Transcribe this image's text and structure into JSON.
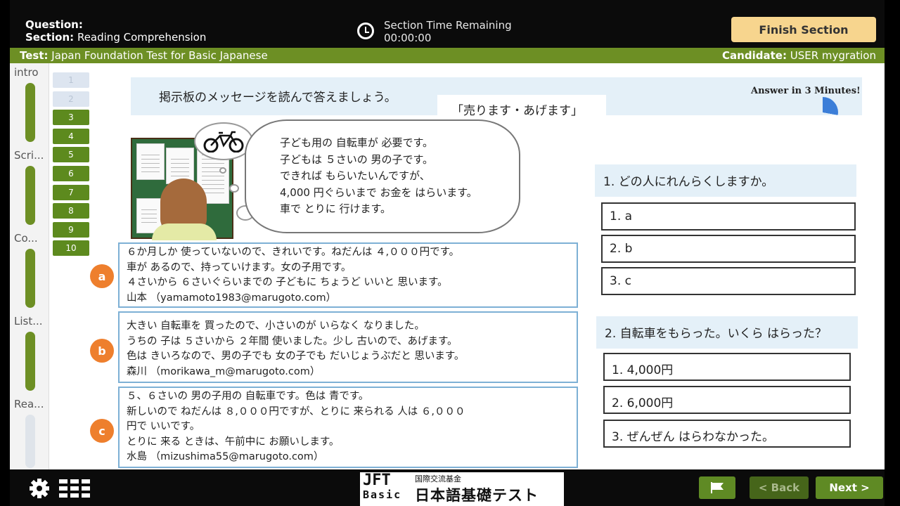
{
  "header": {
    "question_label": "Question:",
    "section_label": "Section:",
    "section_name": "Reading Comprehension",
    "timer_title": "Section Time Remaining",
    "timer_value": "00:00:00",
    "finish_label": "Finish Section"
  },
  "testbar": {
    "test_label": "Test:",
    "test_name": "Japan Foundation Test for Basic Japanese",
    "candidate_label": "Candidate:",
    "candidate_name": "USER mygration"
  },
  "left_nav": {
    "sections": [
      {
        "label": "intro",
        "done": true
      },
      {
        "label": "Scri...",
        "done": true
      },
      {
        "label": "Co...",
        "done": true
      },
      {
        "label": "List...",
        "done": true
      },
      {
        "label": "Rea...",
        "done": false
      }
    ]
  },
  "question_numbers": [
    {
      "num": "1",
      "state": "todo"
    },
    {
      "num": "2",
      "state": "todo"
    },
    {
      "num": "3",
      "state": "done"
    },
    {
      "num": "4",
      "state": "done"
    },
    {
      "num": "5",
      "state": "done"
    },
    {
      "num": "6",
      "state": "done"
    },
    {
      "num": "7",
      "state": "done"
    },
    {
      "num": "8",
      "state": "done"
    },
    {
      "num": "9",
      "state": "done"
    },
    {
      "num": "10",
      "state": "done"
    }
  ],
  "content": {
    "instruction": "掲示板のメッセージを読んで答えましょう。",
    "answer_in": "Answer in 3 Minutes!",
    "board_title": "「売ります・あげます」",
    "thought": [
      "子ども用の 自転車が 必要です。",
      "子どもは ５さいの 男の子です。",
      "できれば もらいたいんですが、",
      "4,000 円ぐらいまで お金を はらいます。",
      "車で とりに 行けます。"
    ],
    "options": [
      {
        "badge": "a",
        "lines": [
          "６か月しか 使っていないので、きれいです。ねだんは ４,０００円です。",
          "車が あるので、持っていけます。女の子用です。",
          "４さいから ６さいぐらいまでの 子どもに ちょうど いいと 思います。",
          "山本 （yamamoto1983@marugoto.com）"
        ]
      },
      {
        "badge": "b",
        "lines": [
          "大きい 自転車を 買ったので、小さいのが いらなく なりました。",
          "うちの 子は ５さいから ２年間 使いました。少し 古いので、あげます。",
          "色は きいろなので、男の子でも 女の子でも だいじょうぶだと 思います。",
          "森川 （morikawa_m@marugoto.com）"
        ]
      },
      {
        "badge": "c",
        "lines": [
          "５、６さいの 男の子用の 自転車です。色は 青です。",
          "新しいので ねだんは ８,０００円ですが、とりに 来られる 人は ６,０００",
          "円で いいです。",
          "とりに 来る ときは、午前中に お願いします。",
          "水島 （mizushima55@marugoto.com）"
        ]
      }
    ]
  },
  "questions": [
    {
      "text": "1. どの人にれんらくしますか。",
      "choices": [
        "1. a",
        "2. b",
        "3. c"
      ]
    },
    {
      "text": "2. 自転車をもらった。いくら はらった？",
      "choices": [
        "1. 4,000円",
        "2. 6,000円",
        "3. ぜんぜん はらわなかった。"
      ]
    }
  ],
  "footer": {
    "logo_mark_top": "JFT",
    "logo_mark_bottom": "Basic",
    "logo_small": "国際交流基金",
    "logo_big": "日本語基礎テスト",
    "back_label": "< Back",
    "next_label": "Next >"
  },
  "colors": {
    "accent_green": "#6d8f24",
    "finish_button": "#f7d58e",
    "badge_orange": "#ee7f2d",
    "panel_blue": "#e4f0f8"
  }
}
